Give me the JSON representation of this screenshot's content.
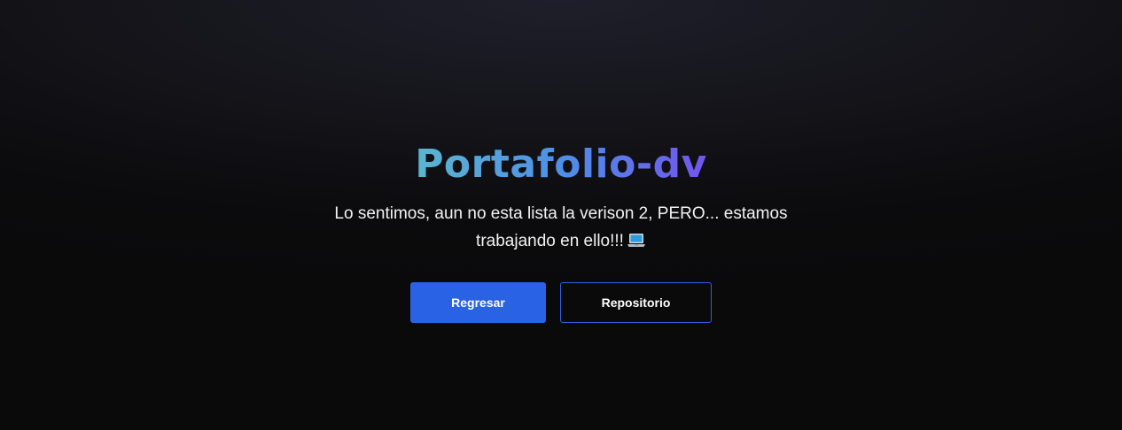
{
  "hero": {
    "title": "Portafolio-dv",
    "message": "Lo sentimos, aun no esta lista la verison 2, PERO... estamos trabajando en ello!!!",
    "message_icon": "laptop-icon"
  },
  "actions": {
    "back_label": "Regresar",
    "repo_label": "Repositorio"
  },
  "colors": {
    "primary": "#2a62e6",
    "title_gradient": [
      "#5bb6d0",
      "#4f8fe8",
      "#7155ee"
    ],
    "background": "#0b0b0d"
  }
}
